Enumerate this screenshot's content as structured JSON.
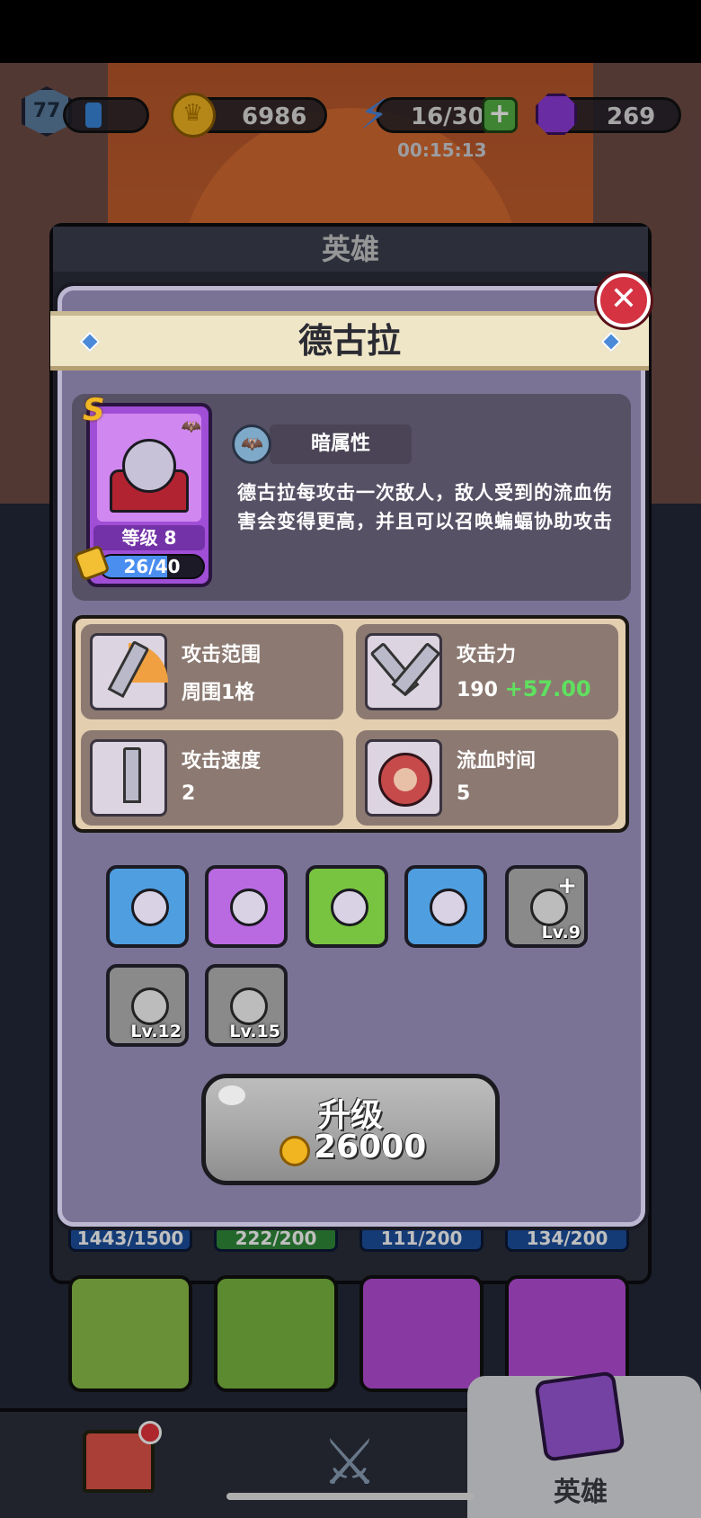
{
  "topbar": {
    "level": "77",
    "gold": "6986",
    "energy": "16/30",
    "energy_timer": "00:15:13",
    "gems": "269"
  },
  "hero_list": {
    "title": "英雄",
    "fragments": [
      "1443/1500",
      "222/200",
      "111/200",
      "134/200"
    ]
  },
  "dialog": {
    "title": "德古拉",
    "close_label": "✕",
    "hero": {
      "rank": "S",
      "level_label": "等级 8",
      "fragments": "26/40",
      "fragment_progress": 0.65
    },
    "attribute": "暗属性",
    "description": "德古拉每攻击一次敌人，敌人受到的流血伤害会变得更高，并且可以召唤蝙蝠协助攻击",
    "stats": [
      {
        "name": "攻击范围",
        "value": "周围1格",
        "icon": "attack-range-icon"
      },
      {
        "name": "攻击力",
        "value": "190",
        "bonus": "+57.00",
        "icon": "attack-power-icon"
      },
      {
        "name": "攻击速度",
        "value": "2",
        "icon": "attack-speed-icon"
      },
      {
        "name": "流血时间",
        "value": "5",
        "icon": "bleed-time-icon"
      }
    ],
    "skills": [
      {
        "lv": "",
        "color": "#4f9ee0",
        "locked": false
      },
      {
        "lv": "",
        "color": "#b96ae0",
        "locked": false
      },
      {
        "lv": "",
        "color": "#78c440",
        "locked": false
      },
      {
        "lv": "",
        "color": "#4f9ee0",
        "locked": false
      },
      {
        "lv": "Lv.9",
        "color": "#8a8a8a",
        "locked": true
      },
      {
        "lv": "Lv.12",
        "color": "#8a8a8a",
        "locked": true
      },
      {
        "lv": "Lv.15",
        "color": "#8a8a8a",
        "locked": true
      }
    ],
    "upgrade": {
      "label": "升级",
      "cost": "26000"
    }
  },
  "nav": {
    "active_label": "英雄"
  },
  "colors": {
    "dialog_bg": "#7b7396",
    "bonus_green": "#5fe05f",
    "close_red": "#d53242"
  }
}
